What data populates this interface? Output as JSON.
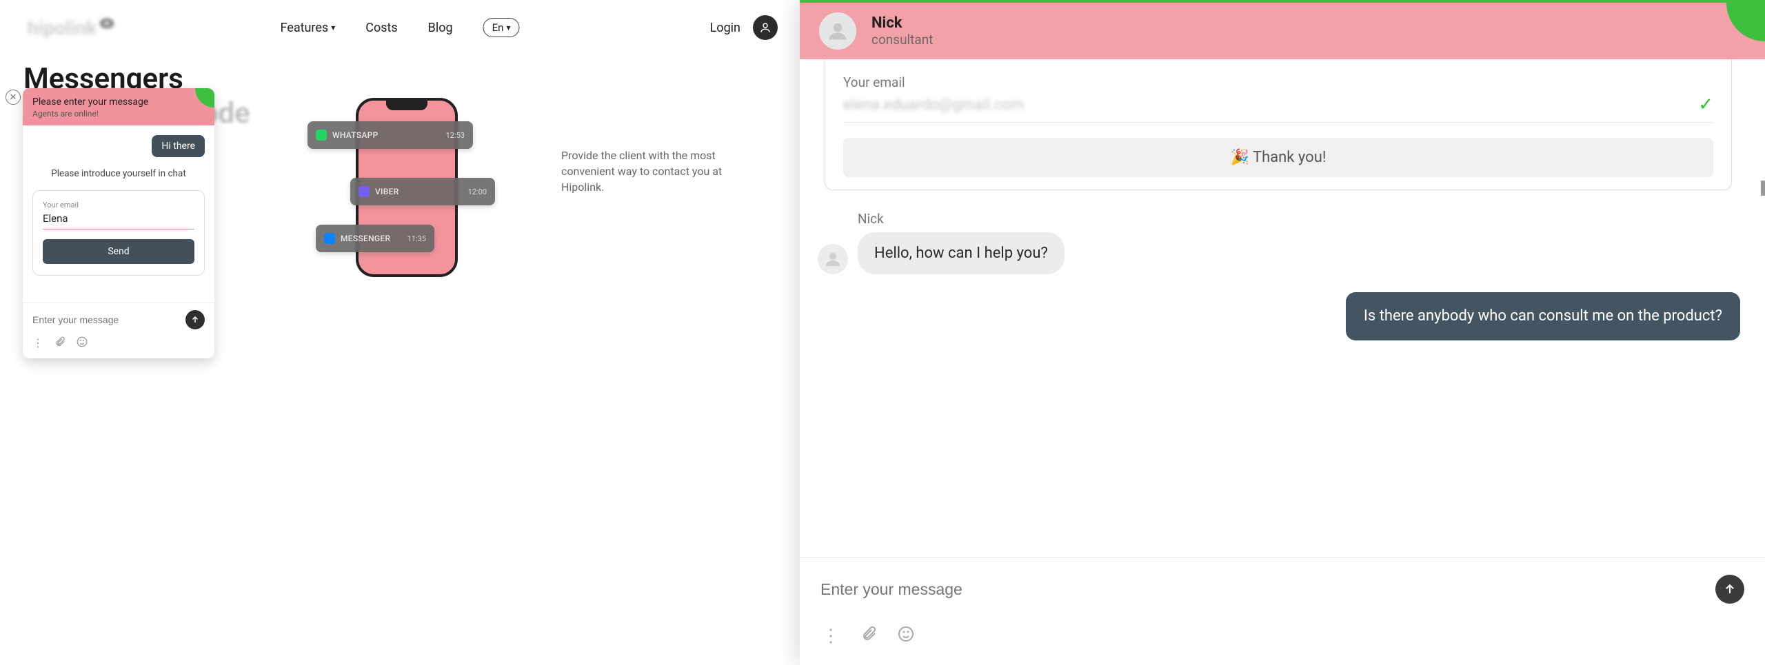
{
  "nav": {
    "features": "Features",
    "costs": "Costs",
    "blog": "Blog",
    "lang": "En",
    "login": "Login"
  },
  "hero": {
    "title_line1": "Messengers",
    "title_line2": "and support code",
    "description": "Provide the client with the most convenient way to contact you at Hipolink."
  },
  "left_chat": {
    "head_title": "Please enter your message",
    "head_sub": "Agents are online!",
    "bubble": "Hi there",
    "prompt": "Please introduce yourself in chat",
    "email_label": "Your email",
    "email_value": "Elena",
    "send_label": "Send",
    "input_placeholder": "Enter your message"
  },
  "notifs": [
    {
      "name": "WHATSAPP",
      "time": "12:53"
    },
    {
      "name": "VIBER",
      "time": "12:00"
    },
    {
      "name": "MESSENGER",
      "time": "11:35"
    }
  ],
  "big_chat": {
    "agent_name": "Nick",
    "agent_role": "consultant",
    "thank_you": {
      "label": "Your email",
      "value": "elena.eduardo@gmail.com",
      "banner": "Thank you!"
    },
    "msg_agent_name": "Nick",
    "msg_agent": "Hello, how can I help you?",
    "msg_user": "Is there anybody who can consult me on the product?",
    "input_placeholder": "Enter your message"
  }
}
